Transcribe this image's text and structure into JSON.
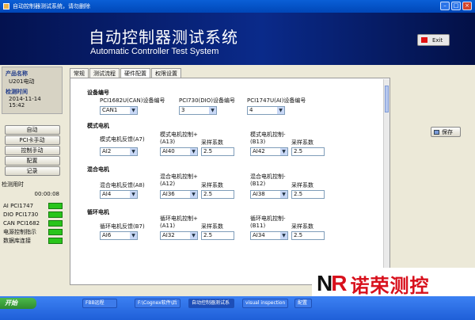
{
  "window": {
    "title": "自动控制器测试系统，请勿删除"
  },
  "header": {
    "title_cn": "自动控制器测试系统",
    "title_en": "Automatic Controller Test System",
    "exit_label": "Exit"
  },
  "left": {
    "product_name_label": "产品名称",
    "product_name": "U201电动",
    "test_time_label": "检测时间",
    "test_time": "2014-11-14 15:42",
    "nav": [
      "自动",
      "PCI卡手动",
      "控制手动",
      "配置",
      "记录"
    ],
    "elapsed_label": "检测用时",
    "elapsed": "00:00:08",
    "statuses": [
      {
        "label": "AI PCI1747",
        "led": true
      },
      {
        "label": "DIO PCI1730",
        "led": true
      },
      {
        "label": "CAN PCI1682",
        "led": true
      },
      {
        "label": "电源控制指示",
        "led": true
      },
      {
        "label": "数据库连接",
        "led": true
      }
    ]
  },
  "tabs": [
    "常规",
    "测试流程",
    "硬件配置",
    "权限设置"
  ],
  "panel": {
    "device_section": "设备编号",
    "can_label": "PCI1682U(CAN)设备编号",
    "can_value": "CAN1",
    "dio_label": "PCI730(DIO)设备编号",
    "dio_value": "3",
    "ai_label": "PCI1747U(AI)设备编号",
    "ai_value": "4",
    "sections": [
      {
        "title": "模式电机",
        "fb_label": "模式电机反馈(A7)",
        "fb_value": "AI2",
        "ctrl_plus_label": "模式电机控制+",
        "ctrl_plus_ch": "(A13)",
        "ctrl_plus_value": "AI40",
        "coef1_label": "采样系数",
        "coef1_value": "2.5",
        "ctrl_minus_label": "模式电机控制-",
        "ctrl_minus_ch": "(B13)",
        "ctrl_minus_value": "AI42",
        "coef2_label": "采样系数",
        "coef2_value": "2.5"
      },
      {
        "title": "混合电机",
        "fb_label": "混合电机反馈(A8)",
        "fb_value": "AI4",
        "ctrl_plus_label": "混合电机控制+",
        "ctrl_plus_ch": "(A12)",
        "ctrl_plus_value": "AI36",
        "coef1_label": "采样系数",
        "coef1_value": "2.5",
        "ctrl_minus_label": "混合电机控制-",
        "ctrl_minus_ch": "(B12)",
        "ctrl_minus_value": "AI38",
        "coef2_label": "采样系数",
        "coef2_value": "2.5"
      },
      {
        "title": "循环电机",
        "fb_label": "循环电机反馈(B7)",
        "fb_value": "AI6",
        "ctrl_plus_label": "循环电机控制+",
        "ctrl_plus_ch": "(A11)",
        "ctrl_plus_value": "AI32",
        "coef1_label": "采样系数",
        "coef1_value": "2.5",
        "ctrl_minus_label": "循环电机控制-",
        "ctrl_minus_ch": "(B11)",
        "ctrl_minus_value": "AI34",
        "coef2_label": "采样系数",
        "coef2_value": "2.5"
      }
    ],
    "save_label": "保存"
  },
  "logo": {
    "mark_n": "N",
    "mark_r": "R",
    "text": "诺荣测控"
  },
  "taskbar": {
    "start": "开始",
    "tasks": [
      "FBB远程",
      "F:\\Cognex软件\\后",
      "自动控制器测试系",
      "visual inspection",
      "配置"
    ]
  },
  "colors": {
    "banner": "#0a2a8a",
    "led_on": "#29c51b",
    "logo_red": "#d8101c",
    "taskbar": "#2a6ae6"
  }
}
